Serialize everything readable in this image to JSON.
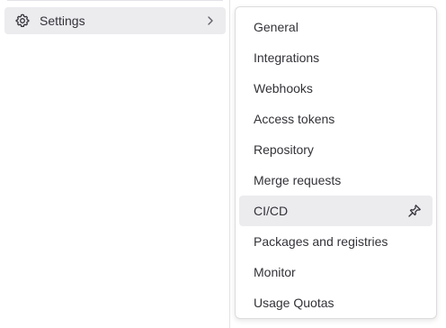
{
  "sidebar": {
    "settings": {
      "label": "Settings",
      "icon": "settings-icon",
      "chevron_icon": "chevron-right-icon"
    }
  },
  "flyout": {
    "items": [
      {
        "label": "General"
      },
      {
        "label": "Integrations"
      },
      {
        "label": "Webhooks"
      },
      {
        "label": "Access tokens"
      },
      {
        "label": "Repository"
      },
      {
        "label": "Merge requests"
      },
      {
        "label": "CI/CD",
        "active": true,
        "icon": "pin-icon"
      },
      {
        "label": "Packages and registries"
      },
      {
        "label": "Monitor"
      },
      {
        "label": "Usage Quotas"
      }
    ]
  },
  "colors": {
    "hover_bg": "#ececef",
    "text": "#333238",
    "border": "#dcdcde"
  }
}
